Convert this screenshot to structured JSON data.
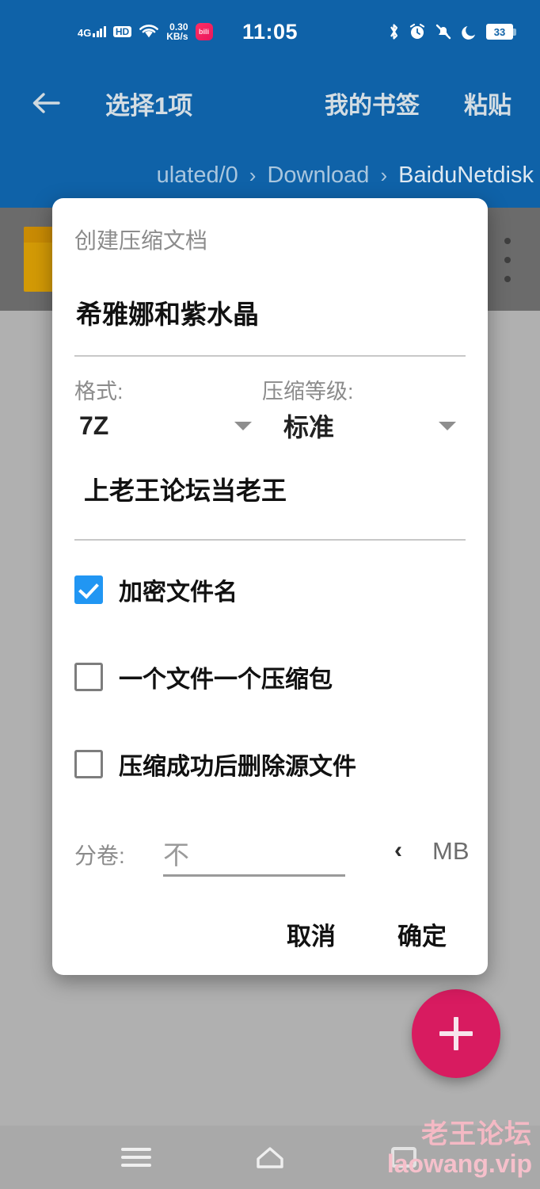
{
  "status_bar": {
    "network_type": "4G",
    "hd_badge": "HD",
    "data_speed": "0.30",
    "data_speed_unit": "KB/s",
    "app_chip_label": "bili",
    "clock": "11:05",
    "battery_percent": "33",
    "icons": [
      "signal-icon",
      "hd-icon",
      "wifi-icon",
      "data-speed-icon",
      "app-icon",
      "bluetooth-icon",
      "alarm-icon",
      "mute-icon",
      "do-not-disturb-icon",
      "battery-icon"
    ]
  },
  "app_bar": {
    "back_label": "←",
    "title": "选择1项",
    "action_bookmarks": "我的书签",
    "action_paste": "粘贴"
  },
  "breadcrumb": {
    "separator": "›",
    "items": [
      {
        "label": "ulated/0",
        "active": false
      },
      {
        "label": "Download",
        "active": false
      },
      {
        "label": "BaiduNetdisk",
        "active": true
      }
    ]
  },
  "dialog": {
    "title": "创建压缩文档",
    "archive_name": "希雅娜和紫水晶",
    "format_label": "格式:",
    "format_value": "7Z",
    "level_label": "压缩等级:",
    "level_value": "标准",
    "password_value": "上老王论坛当老王",
    "checkboxes": [
      {
        "label": "加密文件名",
        "checked": true
      },
      {
        "label": "一个文件一个压缩包",
        "checked": false
      },
      {
        "label": "压缩成功后删除源文件",
        "checked": false
      }
    ],
    "split_label": "分卷:",
    "split_value": "不",
    "split_chevron": "‹",
    "split_unit": "MB",
    "cancel_label": "取消",
    "confirm_label": "确定",
    "checkbox_accent": "#2196f3"
  },
  "fab": {
    "icon": "plus-icon",
    "color": "#d81b60"
  },
  "nav_bar": {
    "recents": "recents-icon",
    "home": "home-icon",
    "back": "back-icon"
  },
  "watermark": {
    "line1": "老王论坛",
    "line2": "laowang.vip"
  },
  "theme": {
    "primary": "#0f62a8",
    "background": "#b0b0b0",
    "selected_row": "#6b6b6b",
    "folder_icon": "#d39a06"
  }
}
